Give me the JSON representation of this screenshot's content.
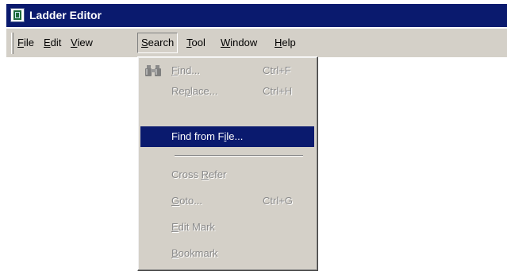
{
  "window": {
    "title": "Ladder Editor",
    "icon": "ladder-editor-app-icon"
  },
  "menubar": {
    "items": [
      {
        "pre": "",
        "key": "F",
        "post": "ile"
      },
      {
        "pre": "",
        "key": "E",
        "post": "dit"
      },
      {
        "pre": "",
        "key": "V",
        "post": "iew"
      },
      {
        "pre": "",
        "key": "S",
        "post": "earch"
      },
      {
        "pre": "",
        "key": "T",
        "post": "ool"
      },
      {
        "pre": "",
        "key": "W",
        "post": "indow"
      },
      {
        "pre": "",
        "key": "H",
        "post": "elp"
      }
    ],
    "active": "Search"
  },
  "search_menu": {
    "items": [
      {
        "pre": "",
        "key": "F",
        "post": "ind...",
        "shortcut": "Ctrl+F",
        "enabled": false,
        "icon": "binoculars-icon"
      },
      {
        "pre": "Re",
        "key": "p",
        "post": "lace...",
        "shortcut": "Ctrl+H",
        "enabled": false
      },
      {
        "pre": "Find from F",
        "key": "i",
        "post": "le...",
        "shortcut": "",
        "enabled": true,
        "highlighted": true
      },
      {
        "pre": "Cross ",
        "key": "R",
        "post": "efer",
        "shortcut": "",
        "enabled": false
      },
      {
        "pre": "",
        "key": "G",
        "post": "oto...",
        "shortcut": "Ctrl+G",
        "enabled": false
      },
      {
        "pre": "",
        "key": "E",
        "post": "dit Mark",
        "shortcut": "",
        "enabled": false
      },
      {
        "pre": "",
        "key": "B",
        "post": "ookmark",
        "shortcut": "",
        "enabled": false
      }
    ]
  },
  "colors": {
    "titlebar": "#0a1a6e",
    "highlight": "#0a1a6e",
    "face": "#d4d0c8",
    "disabled_text": "#8a8a8a"
  }
}
